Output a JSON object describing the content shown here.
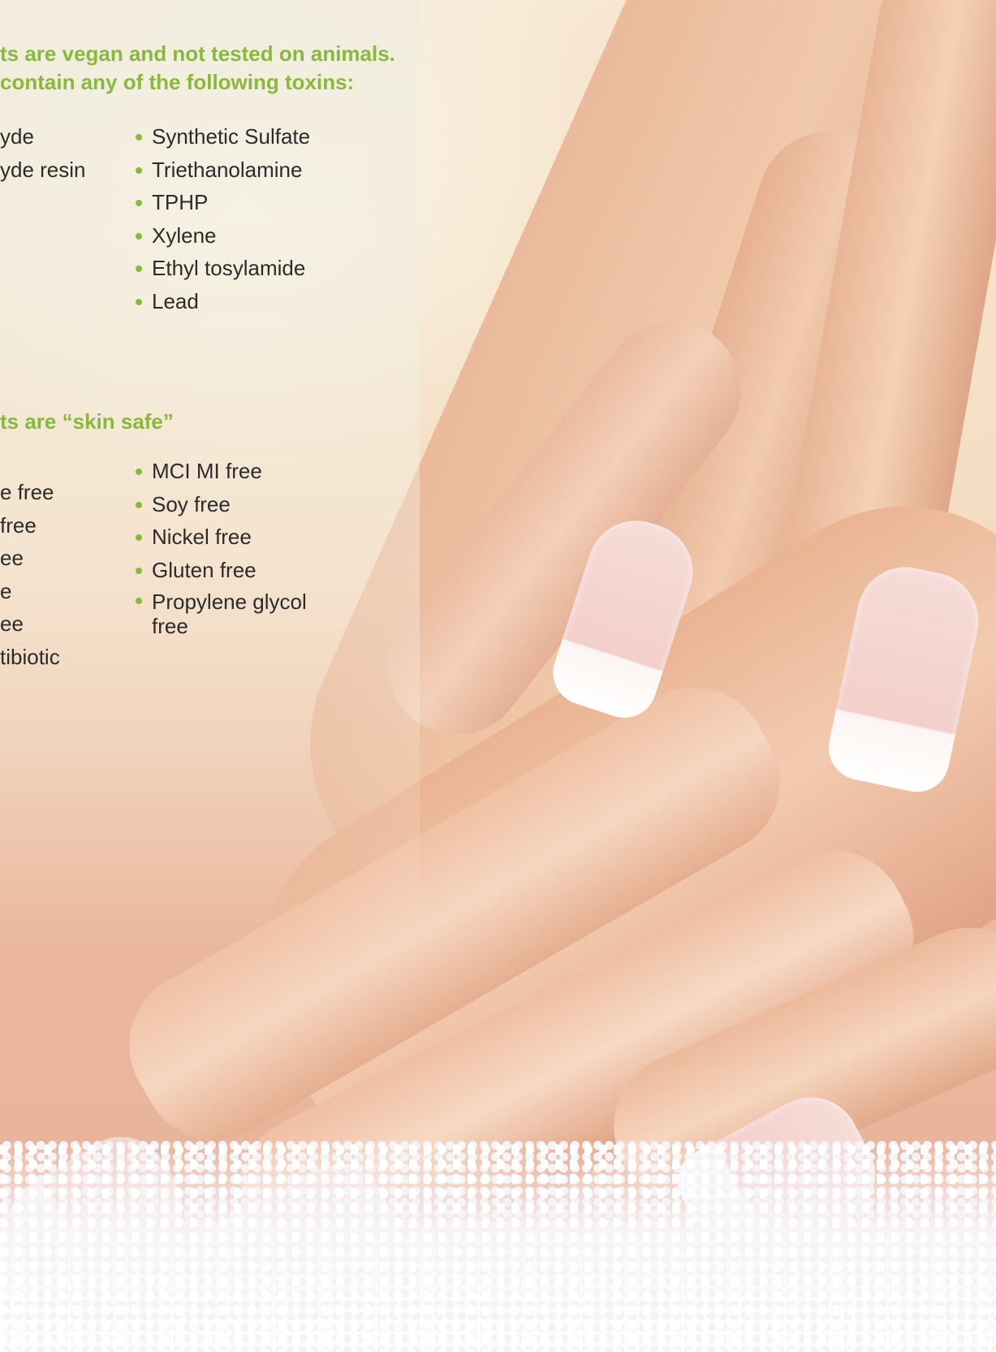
{
  "section_1": {
    "heading_line_1": "ts are vegan and not tested on animals.",
    "heading_line_2": " contain any of the following toxins:",
    "left_items": [
      "yde",
      "",
      "",
      "yde resin"
    ],
    "right_items": [
      "Synthetic Sulfate",
      "Triethanolamine",
      "TPHP",
      "Xylene",
      "Ethyl tosylamide",
      "Lead"
    ]
  },
  "section_2": {
    "heading": "ts are “skin safe”",
    "left_items": [
      "e free",
      "free",
      "ee",
      "e",
      "ee",
      "tibiotic"
    ],
    "right_items": [
      "MCI MI free",
      "Soy free",
      "Nickel free",
      "Gluten free",
      "Propylene glycol free"
    ]
  },
  "colors": {
    "accent": "#8ab83f",
    "text": "#2b2b2b"
  }
}
